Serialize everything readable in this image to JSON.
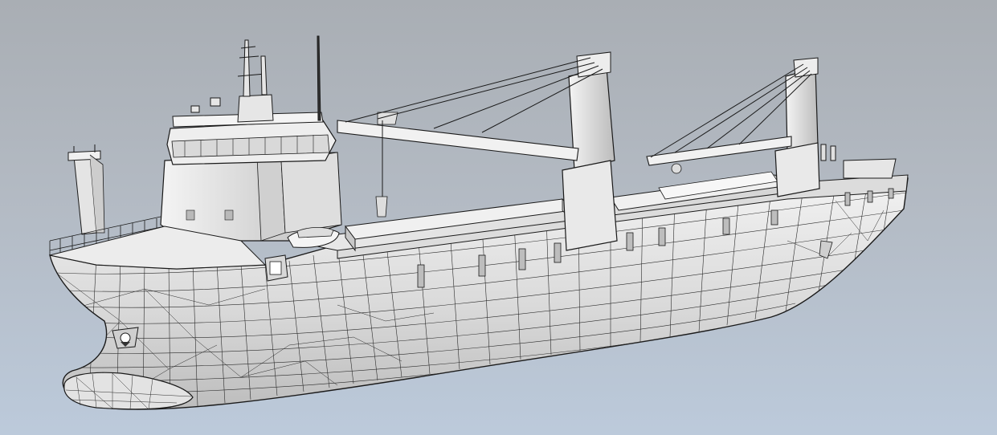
{
  "scene": {
    "subject_icon": "ship-wireframe-3d-model",
    "colors": {
      "background_top": "#a9aeb4",
      "background_bottom": "#bccadb",
      "hull": "#e6e6e6",
      "hull_shadow": "#c7c7c7",
      "superstructure": "#efefef",
      "edge": "#1a1a1a"
    }
  }
}
